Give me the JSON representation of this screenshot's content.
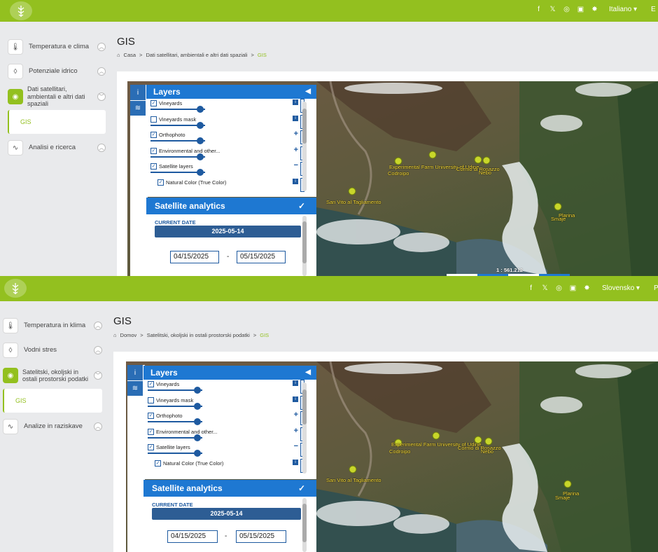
{
  "top": {
    "language": "Italiano",
    "language_extra": "E",
    "sidebar": [
      {
        "label": "Temperatura e clima",
        "icon": "thermometer-icon"
      },
      {
        "label": "Potenziale idrico",
        "icon": "drop-icon"
      },
      {
        "label": "Dati satellitari, ambientali e altri dati spaziali",
        "icon": "eye-icon"
      },
      {
        "label": "Analisi e ricerca",
        "icon": "pulse-icon"
      }
    ],
    "sub_item": "GIS",
    "title": "GIS",
    "breadcrumb": {
      "home": "Casa",
      "section": "Dati satellitari, ambientali e altri dati spaziali",
      "current": "GIS"
    },
    "scale": "1 : 561.212"
  },
  "bottom": {
    "language": "Slovensko",
    "language_extra": "P",
    "sidebar": [
      {
        "label": "Temperatura in klima",
        "icon": "thermometer-icon"
      },
      {
        "label": "Vodni stres",
        "icon": "drop-icon"
      },
      {
        "label": "Satelitski, okoljski in ostali prostorski podatki",
        "icon": "eye-icon"
      },
      {
        "label": "Analize in raziskave",
        "icon": "pulse-icon"
      }
    ],
    "sub_item": "GIS",
    "title": "GIS",
    "breadcrumb": {
      "home": "Domov",
      "section": "Satelitski, okoljski in ostali prostorski podatki",
      "current": "GIS"
    }
  },
  "panel": {
    "layers_title": "Layers",
    "layers": [
      {
        "name": "Vineyards",
        "checked": true,
        "control": "i"
      },
      {
        "name": "Vineyards mask",
        "checked": false,
        "control": "i"
      },
      {
        "name": "Orthophoto",
        "checked": true,
        "control": "+"
      },
      {
        "name": "Environmental and other...",
        "checked": true,
        "control": "+"
      },
      {
        "name": "Satellite layers",
        "checked": true,
        "control": "−"
      },
      {
        "name": "Natural Color (True Color)",
        "checked": true,
        "control": "i"
      }
    ],
    "satellite_title": "Satellite analytics",
    "current_date_label": "CURRENT DATE",
    "current_date": "2025-05-14",
    "date_from": "04/15/2025",
    "date_to": "05/15/2025",
    "date_sep": "-"
  },
  "map_labels": {
    "farm": "Experimental Farm University of Udine",
    "codroipo": "Codroipo",
    "cormo": "Cormo di Rosazzo",
    "nebo": "Nebo",
    "sanvito": "San Vito al Tagliamento",
    "plarina": "Plarina",
    "smaje": "Smaje"
  },
  "colors": {
    "accent": "#93c01f",
    "panel_blue": "#1e78d2",
    "date_blue": "#2d5d94",
    "label_yellow": "#ffe23b"
  }
}
